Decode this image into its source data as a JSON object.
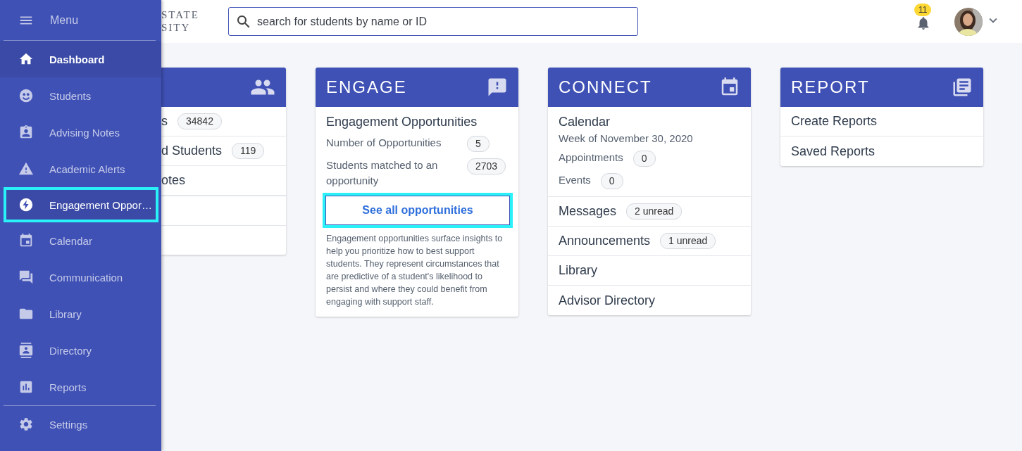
{
  "drawer": {
    "menu_label": "Menu",
    "items": [
      {
        "label": "Dashboard",
        "selected": true,
        "highlighted": false
      },
      {
        "label": "Students",
        "selected": false,
        "highlighted": false
      },
      {
        "label": "Advising Notes",
        "selected": false,
        "highlighted": false
      },
      {
        "label": "Academic Alerts",
        "selected": false,
        "highlighted": false
      },
      {
        "label": "Engagement Oppor…",
        "selected": false,
        "highlighted": true
      },
      {
        "label": "Calendar",
        "selected": false,
        "highlighted": false
      },
      {
        "label": "Communication",
        "selected": false,
        "highlighted": false
      },
      {
        "label": "Library",
        "selected": false,
        "highlighted": false
      },
      {
        "label": "Directory",
        "selected": false,
        "highlighted": false
      },
      {
        "label": "Reports",
        "selected": false,
        "highlighted": false
      }
    ],
    "footer_items": [
      {
        "label": "Settings",
        "selected": false,
        "highlighted": false
      }
    ]
  },
  "header": {
    "logo_lines": [
      "STATE",
      "SITY"
    ],
    "search": {
      "placeholder": "search for students by name or ID"
    },
    "notifications": {
      "count": "11"
    }
  },
  "cards": [
    {
      "kind": "list",
      "rows": [
        {
          "label": "s",
          "badge": "34842"
        },
        {
          "label": "d Students",
          "badge": "119"
        },
        {
          "label": "otes"
        }
      ]
    },
    {
      "kind": "engage",
      "title": "ENGAGE",
      "heading": "Engagement Opportunities",
      "stats": [
        {
          "label": "Number of Opportunities",
          "value": "5"
        },
        {
          "label": "Students matched to an opportunity",
          "value": "2703"
        }
      ],
      "button": {
        "label": "See all opportunities",
        "highlighted": true
      },
      "description": "Engagement opportunities surface insights to help you prioritize how to best support students. They represent circumstances that are predictive of a student's likelihood to persist and where they could benefit from engaging with support staff."
    },
    {
      "kind": "connect",
      "title": "CONNECT",
      "calendar": {
        "heading": "Calendar",
        "week": "Week of November 30, 2020",
        "stats": [
          {
            "label": "Appointments",
            "value": "0"
          },
          {
            "label": "Events",
            "value": "0"
          }
        ]
      },
      "rows": [
        {
          "label": "Messages",
          "badge": "2 unread"
        },
        {
          "label": "Announcements",
          "badge": "1 unread"
        },
        {
          "label": "Library"
        },
        {
          "label": "Advisor Directory"
        }
      ]
    },
    {
      "kind": "list",
      "title": "REPORT",
      "rows": [
        {
          "label": "Create Reports"
        },
        {
          "label": "Saved Reports"
        }
      ]
    }
  ]
}
